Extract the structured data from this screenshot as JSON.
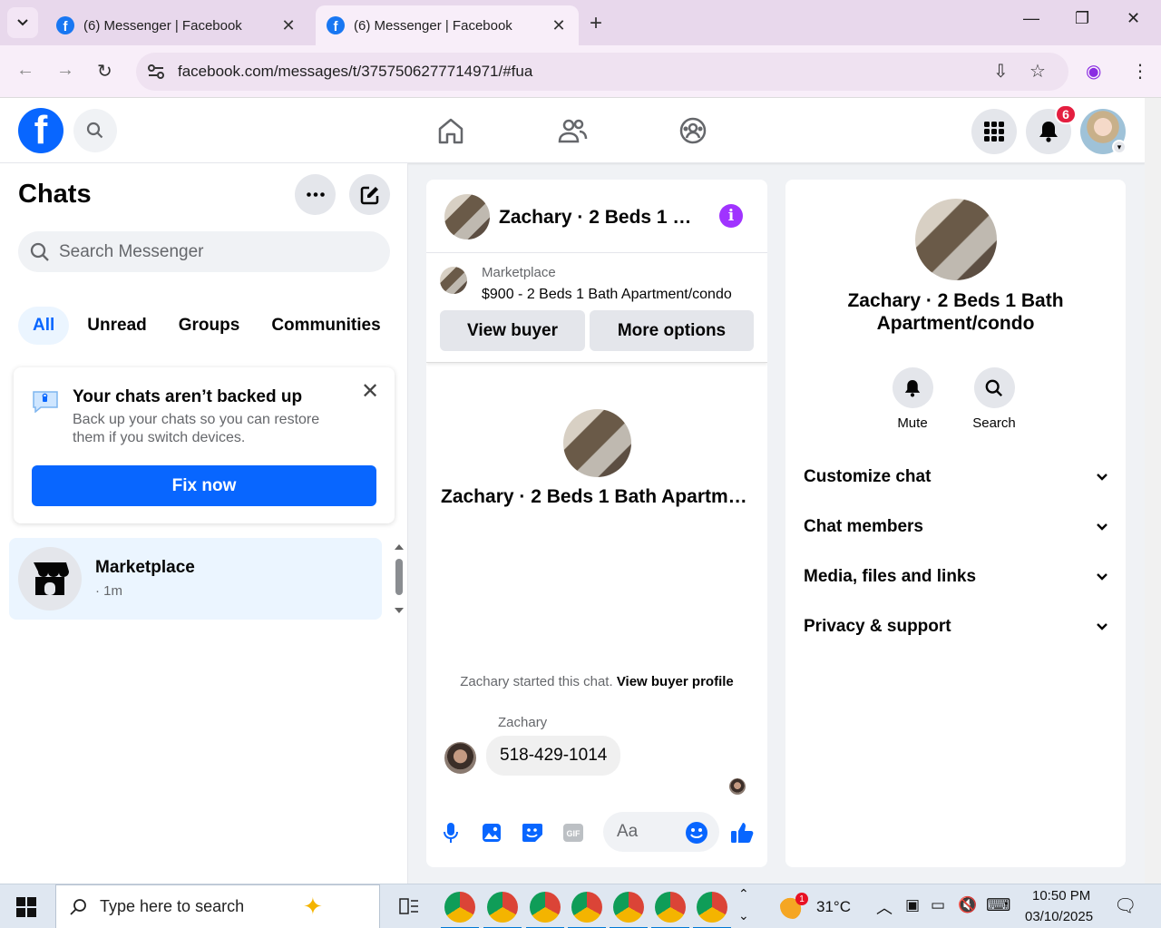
{
  "browser": {
    "tabs": [
      {
        "title": "(6) Messenger | Facebook",
        "active": false
      },
      {
        "title": "(6) Messenger | Facebook",
        "active": true
      }
    ],
    "new_tab": "+",
    "url": "facebook.com/messages/t/3757506277714971/#fua"
  },
  "header": {
    "logo": "f",
    "notifications_count": "6",
    "icons": [
      "search-icon",
      "home-icon",
      "friends-icon",
      "groups-icon",
      "apps-grid-icon",
      "bell-icon"
    ]
  },
  "sidebar": {
    "title": "Chats",
    "search_placeholder": "Search Messenger",
    "filters": [
      "All",
      "Unread",
      "Groups",
      "Communities"
    ],
    "backup": {
      "title": "Your chats aren’t backed up",
      "description": "Back up your chats so you can restore them if you switch devices.",
      "button": "Fix now"
    },
    "chats": [
      {
        "name": "Marketplace",
        "time": "· 1m"
      }
    ]
  },
  "conversation": {
    "title": "Zachary · 2 Beds 1 Bath Apartment/condo",
    "marketplace_label": "Marketplace",
    "listing": "$900 - 2 Beds 1 Bath Apartment/condo",
    "view_buyer": "View buyer",
    "more_options": "More options",
    "started_text": "Zachary started this chat.",
    "started_link": "View buyer profile",
    "sender": "Zachary",
    "message": "518-429-1014",
    "composer_placeholder": "Aa"
  },
  "info_panel": {
    "title": "Zachary · 2 Beds 1 Bath Apartment/condo",
    "actions": [
      "Mute",
      "Search"
    ],
    "sections": [
      "Customize chat",
      "Chat members",
      "Media, files and links",
      "Privacy & support"
    ]
  },
  "taskbar": {
    "search_placeholder": "Type here to search",
    "weather": "31°C",
    "weather_badge": "1",
    "time": "10:50 PM",
    "date": "03/10/2025"
  },
  "colors": {
    "brand": "#0866ff",
    "info": "#a033ff",
    "badge": "#e41e3f"
  }
}
